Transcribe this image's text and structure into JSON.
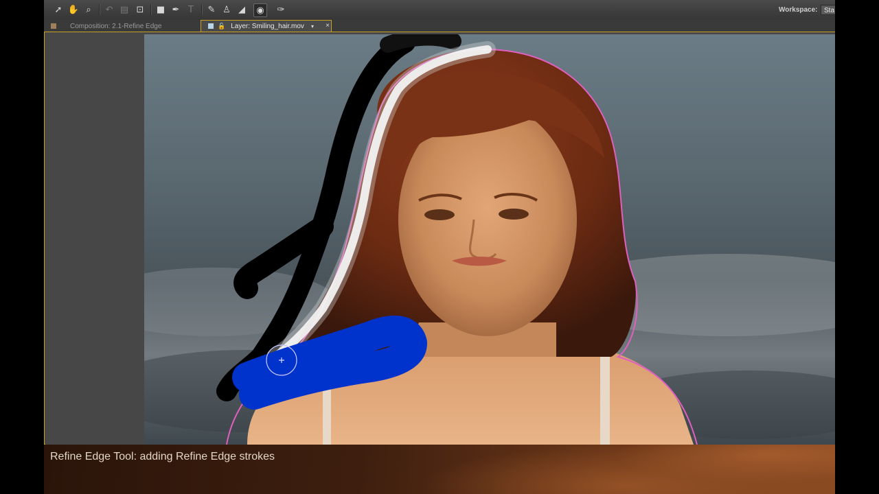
{
  "toolbar": {
    "tools": [
      {
        "icon": "selection-arrow-icon",
        "glyph": "➚"
      },
      {
        "icon": "hand-icon",
        "glyph": "✋"
      },
      {
        "icon": "zoom-icon",
        "glyph": "⌕"
      },
      {
        "icon": "rotate-icon",
        "glyph": "↶"
      },
      {
        "icon": "camera-icon",
        "glyph": "▤"
      },
      {
        "icon": "pan-behind-icon",
        "glyph": "⊡"
      },
      {
        "icon": "rectangle-mask-icon",
        "glyph": "■"
      },
      {
        "icon": "pen-icon",
        "glyph": "✒"
      },
      {
        "icon": "text-icon",
        "glyph": "T"
      },
      {
        "icon": "brush-icon",
        "glyph": "✎"
      },
      {
        "icon": "clone-stamp-icon",
        "glyph": "♙"
      },
      {
        "icon": "eraser-icon",
        "glyph": "◢"
      },
      {
        "icon": "roto-brush-icon",
        "glyph": "◉"
      },
      {
        "icon": "puppet-pin-icon",
        "glyph": "✑"
      }
    ],
    "workspace_label": "Workspace:",
    "workspace_value": "Sta"
  },
  "tabs": {
    "composition_label": "Composition: 2.1-Refine Edge",
    "layer_label": "Layer: Smiling_hair.mov",
    "layer_dropdown_glyph": "▾",
    "close_glyph": "×"
  },
  "caption": {
    "text": "Refine Edge Tool: adding Refine Edge strokes"
  },
  "colors": {
    "panel_border": "#c9a227",
    "refine_stroke": "#0033cc",
    "roto_outline": "#e060c0"
  }
}
